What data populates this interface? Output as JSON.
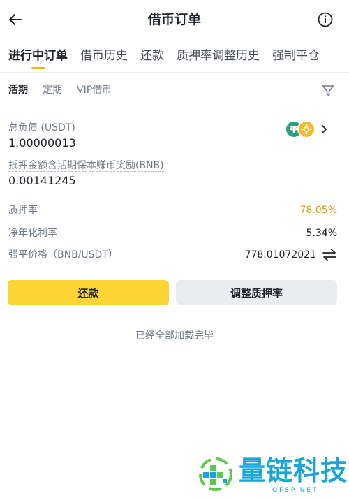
{
  "header": {
    "title": "借币订单",
    "back_icon": "arrow-left-icon",
    "info_icon": "info-circle-icon"
  },
  "tabs": [
    {
      "label": "进行中订单",
      "active": true
    },
    {
      "label": "借币历史",
      "active": false
    },
    {
      "label": "还款",
      "active": false
    },
    {
      "label": "质押率调整历史",
      "active": false
    },
    {
      "label": "强制平仓",
      "active": false
    }
  ],
  "subtabs": [
    {
      "label": "活期",
      "active": true
    },
    {
      "label": "定期",
      "active": false
    },
    {
      "label": "VIP借币",
      "active": false
    }
  ],
  "order": {
    "total_debt_label": "总负债 (USDT)",
    "total_debt_value": "1.00000013",
    "collateral_label": "抵押金额含活期保本赚币奖励(BNB)",
    "collateral_value": "0.00141245",
    "ltv_label": "质押率",
    "ltv_value": "78.05%",
    "apr_label": "净年化利率",
    "apr_value": "5.34%",
    "liq_price_label": "强平价格（BNB/USDT）",
    "liq_price_value": "778.01072021",
    "coins": [
      "usdt-icon",
      "bnb-icon"
    ]
  },
  "actions": {
    "repay_label": "还款",
    "adjust_label": "调整质押率"
  },
  "footer": {
    "end_text": "已经全部加载完毕"
  },
  "watermark": {
    "text": "量链科技",
    "sub": "QFSP.NET"
  },
  "colors": {
    "accent": "#fcd535",
    "ltv": "#d89f00",
    "text": "#1e2329",
    "muted": "#707a8a"
  }
}
